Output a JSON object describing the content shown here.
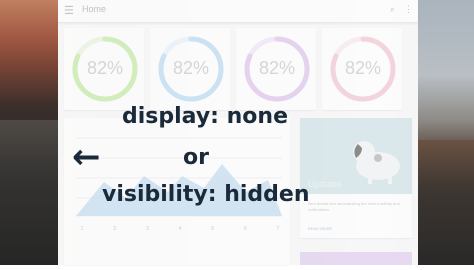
{
  "appbar": {
    "title": "Home",
    "menu_icon": "menu-icon",
    "search_icon": "search-icon",
    "more_icon": "more-vertical-icon"
  },
  "stat_cards": [
    {
      "value": "82%",
      "progress": 0.82,
      "color": "#d6f1bf"
    },
    {
      "value": "82%",
      "progress": 0.82,
      "color": "#cfe6f7"
    },
    {
      "value": "82%",
      "progress": 0.82,
      "color": "#e8d6f3"
    },
    {
      "value": "82%",
      "progress": 0.82,
      "color": "#f6d7df"
    }
  ],
  "updates": {
    "title": "Updates",
    "body": "Item details text summarizing the recent activity and notifications",
    "link": "READ MORE"
  },
  "chart_card": {
    "x_ticks": [
      "1",
      "2",
      "3",
      "4",
      "5",
      "6",
      "7"
    ],
    "area_color": "#cfe3f3"
  },
  "overlay": {
    "line1": "display: none",
    "line2": "or",
    "line3": "visibility: hidden",
    "arrow": "←"
  }
}
